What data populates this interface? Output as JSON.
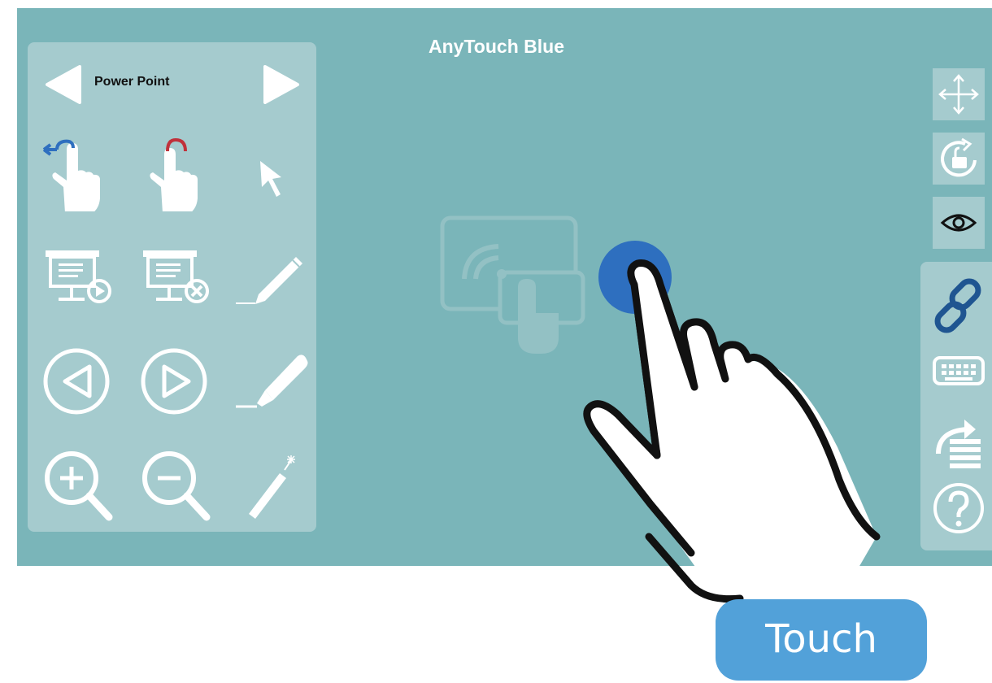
{
  "app": {
    "title": "AnyTouch Blue"
  },
  "panel": {
    "mode_label": "Power Point"
  },
  "touch_button": {
    "label": "Touch"
  },
  "colors": {
    "background": "#7ab5b9",
    "panel": "#a5cbce",
    "accent_blue": "#2e6fbf",
    "accent_red": "#c0313b",
    "touch_button": "#52a1d9",
    "link_icon": "#1f5591"
  },
  "icons": {
    "left_panel": [
      "swipe-left-hand-icon",
      "swipe-right-hand-icon",
      "pointer-arrow-icon",
      "presentation-play-icon",
      "presentation-stop-icon",
      "pen-icon",
      "previous-slide-icon",
      "next-slide-icon",
      "highlighter-icon",
      "zoom-in-icon",
      "zoom-out-icon",
      "laser-pointer-icon"
    ],
    "right_toolbar": [
      "move-icon",
      "rotate-lock-icon",
      "eye-icon",
      "link-icon",
      "keyboard-icon",
      "share-list-icon",
      "help-icon"
    ]
  }
}
